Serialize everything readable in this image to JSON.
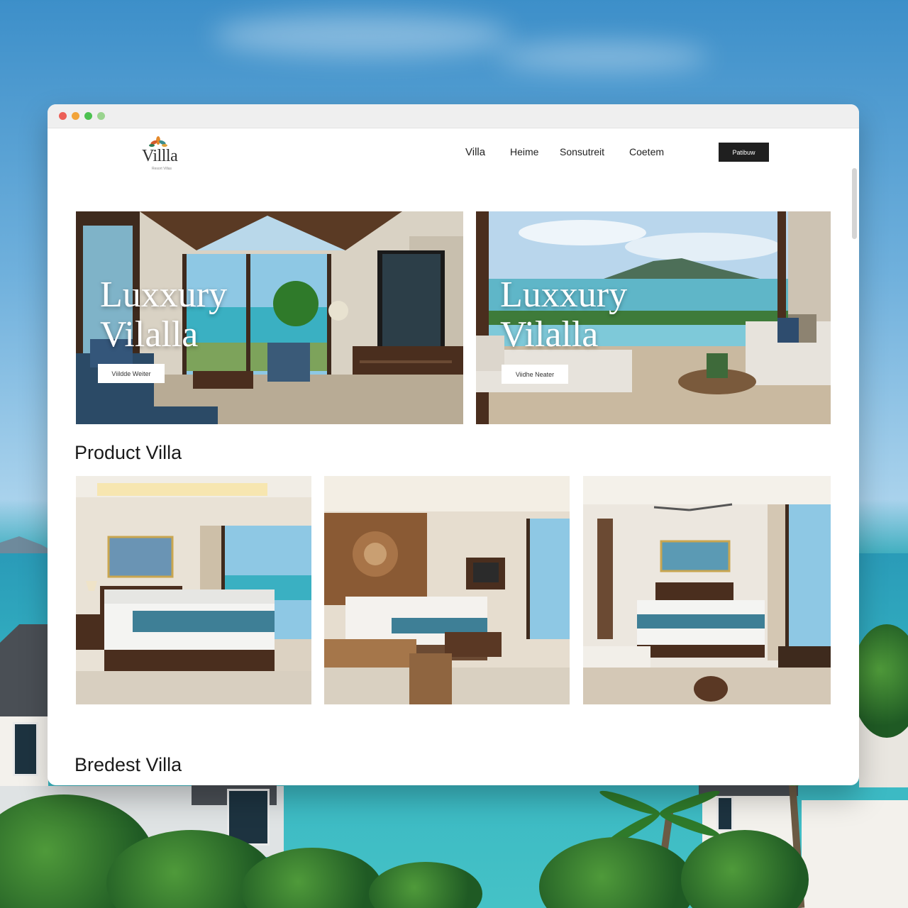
{
  "browser": {
    "dots": [
      "#ec5f57",
      "#f2a43a",
      "#4cc150",
      "#9ad48f"
    ]
  },
  "nav": {
    "logo_text": "Villla",
    "logo_tagline": "Resort Villas",
    "links": [
      "Villa",
      "Heime",
      "Sonsutreit",
      "Coetem"
    ],
    "cta_label": "Patibuw"
  },
  "hero": [
    {
      "title_line1": "Luxxury",
      "title_line2": "Vilalla",
      "button_label": "Viildde Weiter"
    },
    {
      "title_line1": "Luxxury",
      "title_line2": "Vilalla",
      "button_label": "Viidhe Neater"
    }
  ],
  "sections": {
    "product_title": "Product Villa",
    "bredest_title": "Bredest Villa"
  },
  "colors": {
    "accent_dark": "#1f1f1f",
    "teal_runner": "#3e7f96",
    "wood": "#5a3824"
  }
}
